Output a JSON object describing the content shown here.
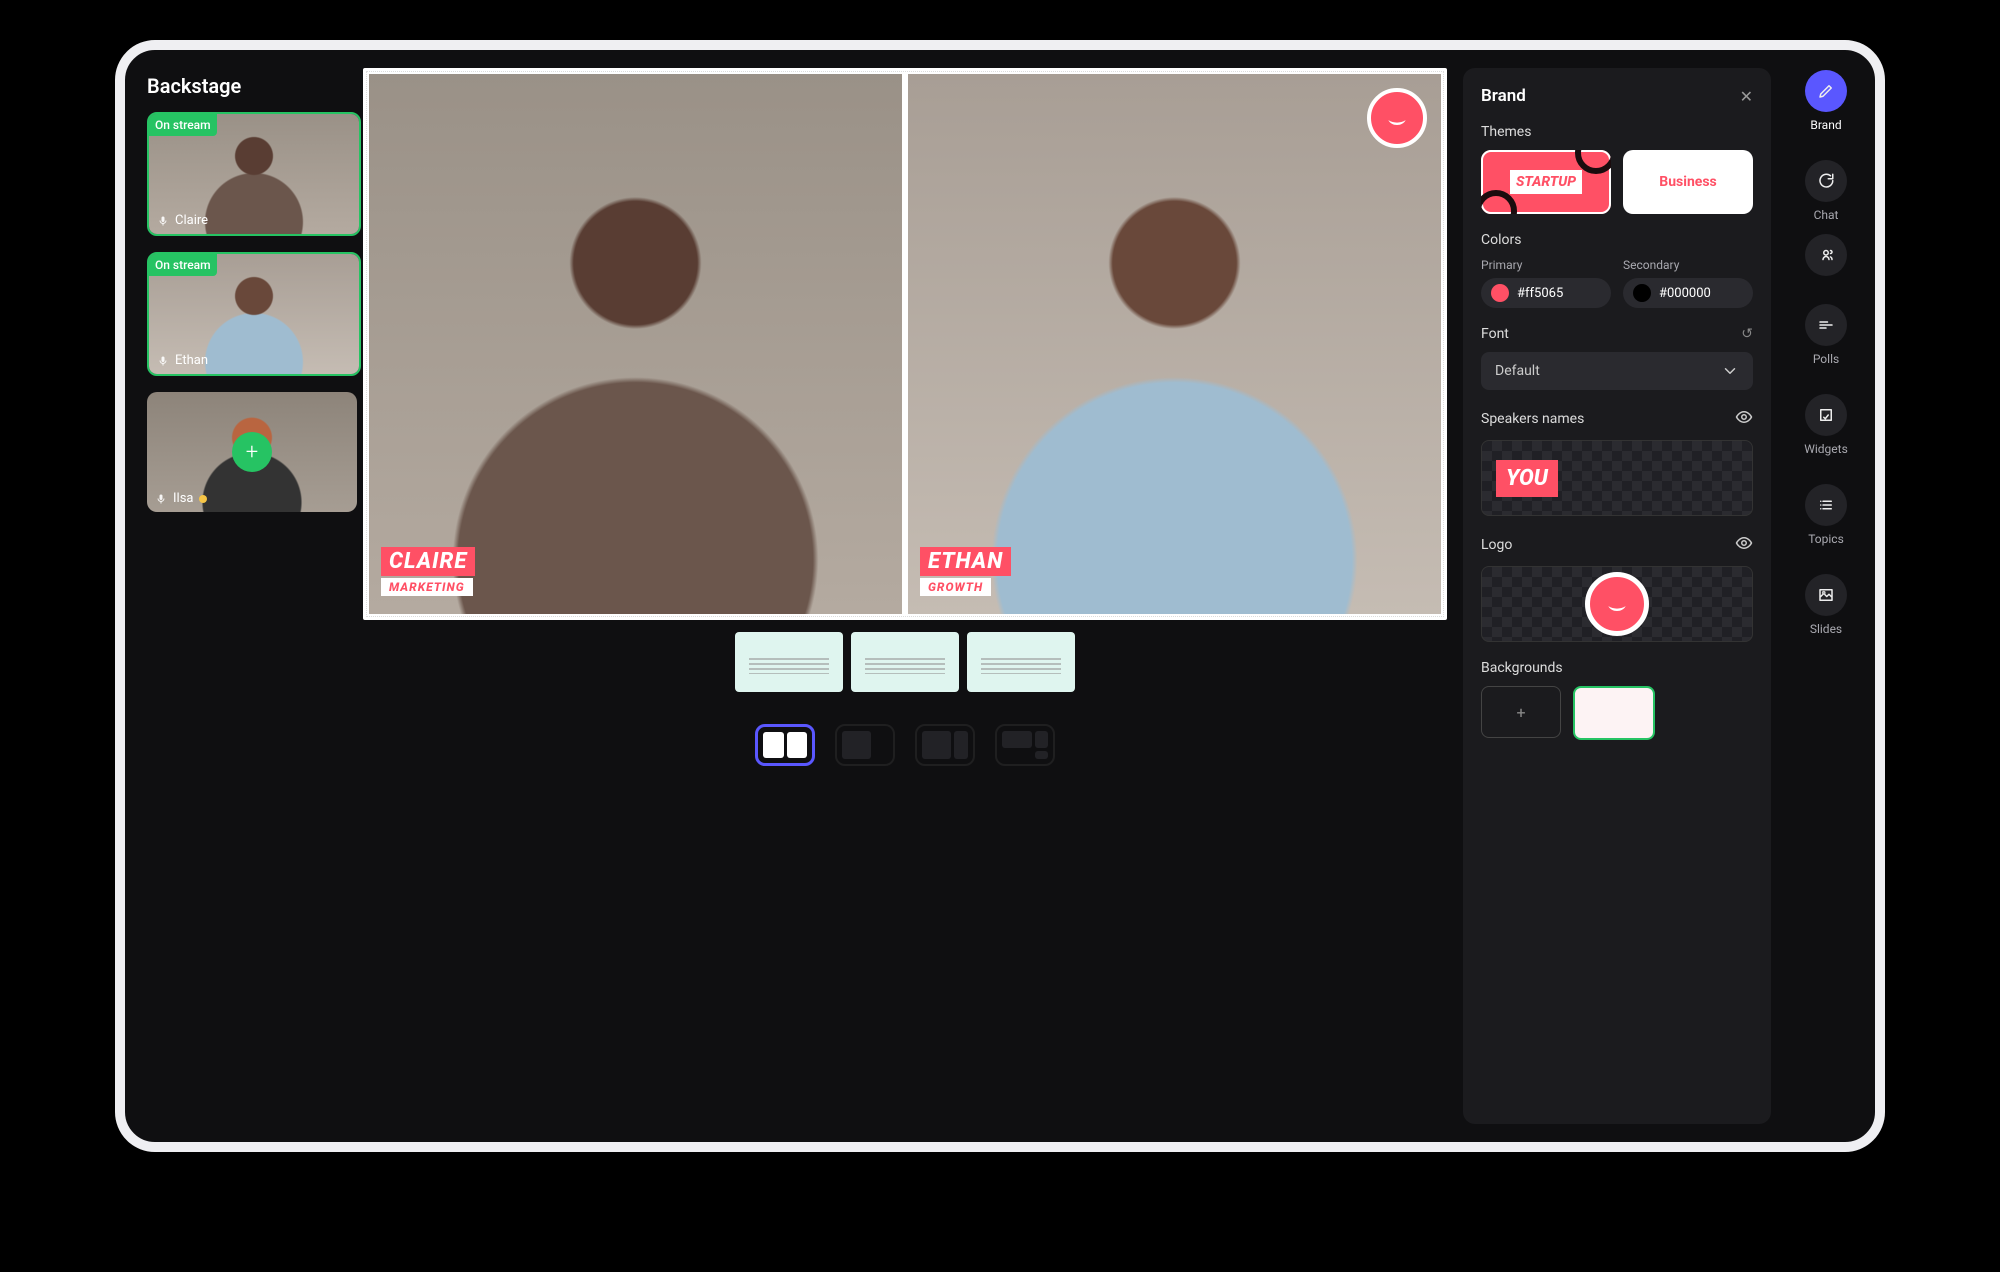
{
  "backstage": {
    "title": "Backstage",
    "participants": [
      {
        "name": "Claire",
        "status": "On stream",
        "onStream": true
      },
      {
        "name": "Ethan",
        "status": "On stream",
        "onStream": true
      },
      {
        "name": "Ilsa",
        "status": "",
        "onStream": false
      }
    ]
  },
  "stage": {
    "speakers": [
      {
        "name": "CLAIRE",
        "subtitle": "MARKETING"
      },
      {
        "name": "ETHAN",
        "subtitle": "GROWTH"
      }
    ]
  },
  "brandPanel": {
    "title": "Brand",
    "sections": {
      "themes": "Themes",
      "colors": "Colors",
      "font": "Font",
      "speakers": "Speakers names",
      "logo": "Logo",
      "backgrounds": "Backgrounds"
    },
    "themes": [
      {
        "label": "STARTUP",
        "selected": true
      },
      {
        "label": "Business",
        "selected": false
      }
    ],
    "colors": {
      "primaryLabel": "Primary",
      "primary": "#ff5065",
      "secondaryLabel": "Secondary",
      "secondary": "#000000"
    },
    "font": {
      "value": "Default"
    },
    "speakerTag": "YOU"
  },
  "rightNav": [
    {
      "key": "brand",
      "label": "Brand",
      "active": true
    },
    {
      "key": "chat",
      "label": "Chat",
      "active": false
    },
    {
      "key": "polls",
      "label": "Polls",
      "active": false
    },
    {
      "key": "widgets",
      "label": "Widgets",
      "active": false
    },
    {
      "key": "topics",
      "label": "Topics",
      "active": false
    },
    {
      "key": "slides",
      "label": "Slides",
      "active": false
    }
  ]
}
